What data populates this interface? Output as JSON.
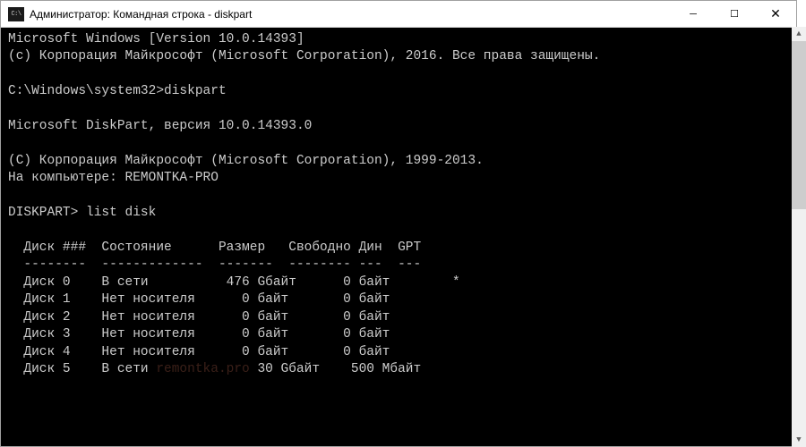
{
  "titlebar": {
    "icon_label": "C:\\",
    "title": "Администратор: Командная строка - diskpart"
  },
  "terminal": {
    "lines": {
      "ver": "Microsoft Windows [Version 10.0.14393]",
      "copyright1": "(c) Корпорация Майкрософт (Microsoft Corporation), 2016. Все права защищены.",
      "blank1": "",
      "prompt1": "C:\\Windows\\system32>diskpart",
      "blank2": "",
      "dp_ver": "Microsoft DiskPart, версия 10.0.14393.0",
      "blank3": "",
      "dp_copyright": "(C) Корпорация Майкрософт (Microsoft Corporation), 1999-2013.",
      "computer": "На компьютере: REMONTKA-PRO",
      "blank4": "",
      "prompt2": "DISKPART> list disk",
      "blank5": "",
      "header": "  Диск ###  Состояние      Размер   Свободно Дин  GPT",
      "divider": "  --------  -------------  -------  -------- ---  ---",
      "row0": "  Диск 0    В сети          476 Gбайт      0 байт        *",
      "row1": "  Диск 1    Нет носителя      0 байт       0 байт",
      "row2": "  Диск 2    Нет носителя      0 байт       0 байт",
      "row3": "  Диск 3    Нет носителя      0 байт       0 байт",
      "row4": "  Диск 4    Нет носителя      0 байт       0 байт",
      "row5_a": "  Диск 5    В сети ",
      "row5_b": " 30 Gбайт    500 Mбайт"
    },
    "watermark": "remontka.pro"
  },
  "win_controls": {
    "minimize": "─",
    "maximize": "☐",
    "close": "✕"
  },
  "scrollbar": {
    "up": "▲",
    "down": "▼"
  }
}
